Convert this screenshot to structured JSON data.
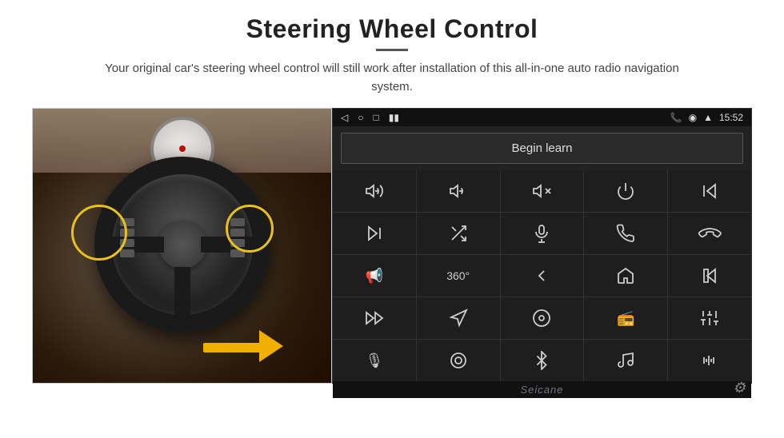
{
  "page": {
    "title": "Steering Wheel Control",
    "divider": true,
    "subtitle": "Your original car's steering wheel control will still work after installation of this all-in-one auto radio navigation system."
  },
  "statusbar": {
    "time": "15:52",
    "icons_left": [
      "back-arrow",
      "circle",
      "square",
      "signal"
    ],
    "icons_right": [
      "phone",
      "location",
      "wifi",
      "time"
    ]
  },
  "begin_learn": {
    "label": "Begin learn"
  },
  "icon_grid": {
    "rows": [
      [
        "vol-up",
        "vol-down",
        "mute",
        "power",
        "prev-track"
      ],
      [
        "next-track",
        "shuffle",
        "mic",
        "phone",
        "hang-up"
      ],
      [
        "horn",
        "360-cam",
        "back",
        "home",
        "skip-back"
      ],
      [
        "fast-forward",
        "navigate",
        "media",
        "radio",
        "eq"
      ],
      [
        "mic2",
        "settings-knob",
        "bluetooth",
        "music",
        "waveform"
      ]
    ]
  },
  "watermark": "Seicane",
  "gear_icon": "⚙"
}
